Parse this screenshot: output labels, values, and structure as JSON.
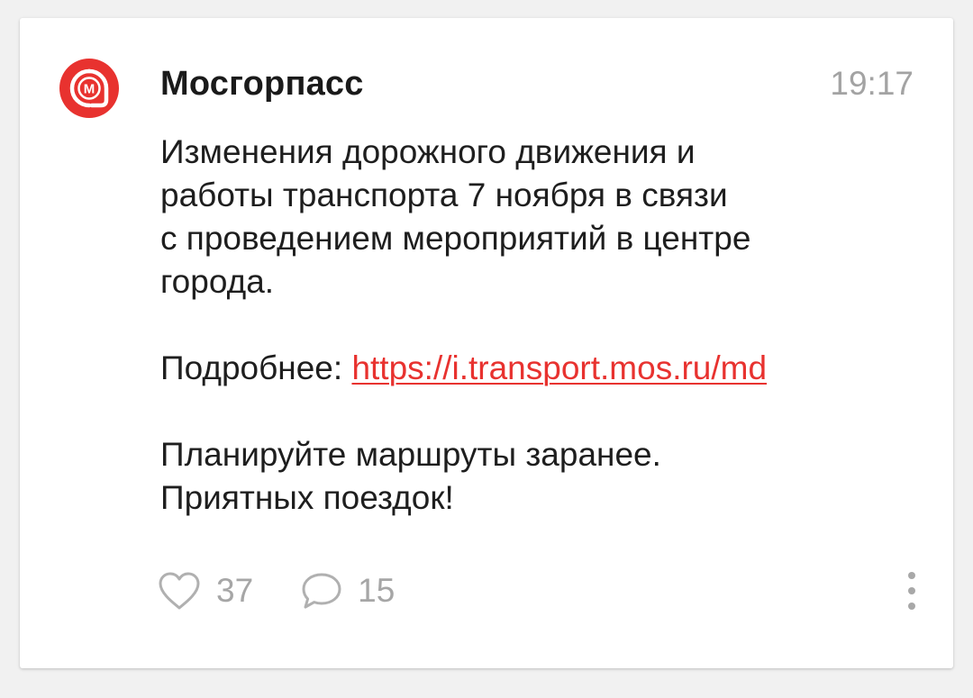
{
  "post": {
    "channel_name": "Мосгорпасс",
    "time": "19:17",
    "avatar_icon": "mosgorpass-logo-icon",
    "brand_color": "#e8322f",
    "paragraph1": "Изменения дорожного движения и\nработы транспорта 7 ноября в связи\nс проведением мероприятий в центре\nгорода.",
    "details_label": "Подробнее: ",
    "details_link": "https://i.transport.mos.ru/md",
    "paragraph3": "Планируйте маршруты заранее.\nПриятных поездок!"
  },
  "footer": {
    "likes_icon": "heart-icon",
    "likes_count": "37",
    "comments_icon": "comment-bubble-icon",
    "comments_count": "15",
    "more_icon": "more-vertical-icon"
  }
}
